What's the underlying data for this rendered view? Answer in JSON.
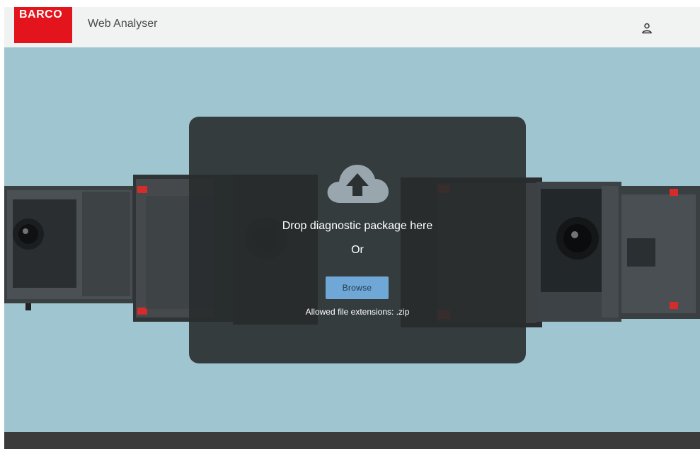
{
  "header": {
    "logo_text": "BARCO",
    "app_title": "Web Analyser",
    "user_icon": "user-icon"
  },
  "dropzone": {
    "icon": "cloud-upload-icon",
    "drop_text": "Drop diagnostic package here",
    "or_text": "Or",
    "browse_label": "Browse",
    "allowed_text": "Allowed file extensions: .zip"
  },
  "colors": {
    "brand_red": "#e3141c",
    "hero_bg": "#9ec5d0",
    "button_blue": "#6fa8d6",
    "footer": "#3b3b3b"
  }
}
